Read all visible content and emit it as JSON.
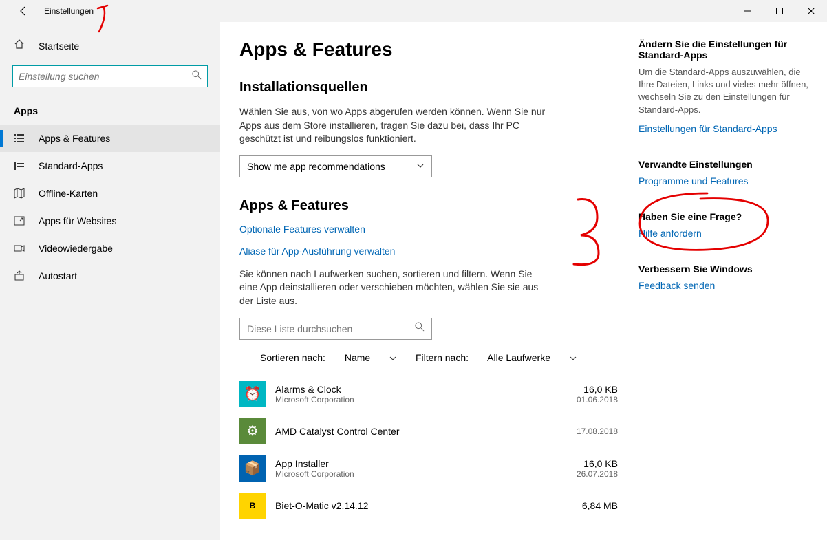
{
  "titlebar": {
    "title": "Einstellungen"
  },
  "sidebar": {
    "home": "Startseite",
    "search_placeholder": "Einstellung suchen",
    "section": "Apps",
    "items": [
      {
        "label": "Apps & Features"
      },
      {
        "label": "Standard-Apps"
      },
      {
        "label": "Offline-Karten"
      },
      {
        "label": "Apps für Websites"
      },
      {
        "label": "Videowiedergabe"
      },
      {
        "label": "Autostart"
      }
    ]
  },
  "main": {
    "h1": "Apps & Features",
    "install_title": "Installationsquellen",
    "install_desc": "Wählen Sie aus, von wo Apps abgerufen werden können. Wenn Sie nur Apps aus dem Store installieren, tragen Sie dazu bei, dass Ihr PC geschützt ist und reibungslos funktioniert.",
    "install_dropdown": "Show me app recommendations",
    "apps_title": "Apps & Features",
    "link_optional": "Optionale Features verwalten",
    "link_alias": "Aliase für App-Ausführung verwalten",
    "apps_desc": "Sie können nach Laufwerken suchen, sortieren und filtern. Wenn Sie eine App deinstallieren oder verschieben möchten, wählen Sie sie aus der Liste aus.",
    "list_search_placeholder": "Diese Liste durchsuchen",
    "sort_label": "Sortieren nach:",
    "sort_value": "Name",
    "filter_label": "Filtern nach:",
    "filter_value": "Alle Laufwerke",
    "apps": [
      {
        "name": "Alarms & Clock",
        "vendor": "Microsoft Corporation",
        "size": "16,0 KB",
        "date": "01.06.2018",
        "icon": "teal",
        "glyph": "⏰"
      },
      {
        "name": "AMD Catalyst Control Center",
        "vendor": "",
        "size": "",
        "date": "17.08.2018",
        "icon": "amd",
        "glyph": "⚙"
      },
      {
        "name": "App Installer",
        "vendor": "Microsoft Corporation",
        "size": "16,0 KB",
        "date": "26.07.2018",
        "icon": "blue",
        "glyph": "📦"
      },
      {
        "name": "Biet-O-Matic v2.14.12",
        "vendor": "",
        "size": "6,84 MB",
        "date": "",
        "icon": "yellow",
        "glyph": "B"
      }
    ]
  },
  "side": {
    "b1_title": "Ändern Sie die Einstellungen für Standard-Apps",
    "b1_text": "Um die Standard-Apps auszuwählen, die Ihre Dateien, Links und vieles mehr öffnen, wechseln Sie zu den Einstellungen für Standard-Apps.",
    "b1_link": "Einstellungen für Standard-Apps",
    "b2_title": "Verwandte Einstellungen",
    "b2_link": "Programme und Features",
    "b3_title": "Haben Sie eine Frage?",
    "b3_link": "Hilfe anfordern",
    "b4_title": "Verbessern Sie Windows",
    "b4_link": "Feedback senden"
  }
}
